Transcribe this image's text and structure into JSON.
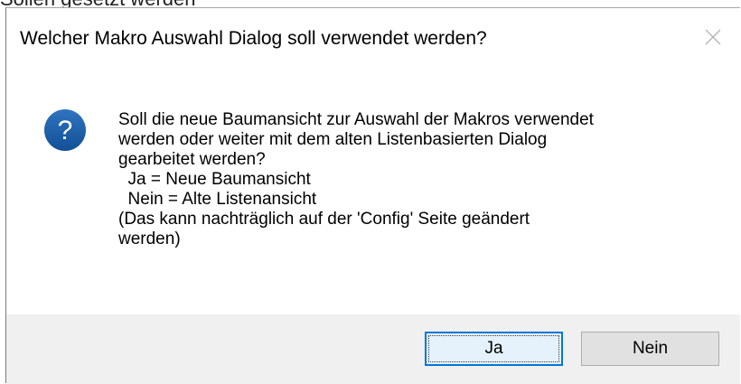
{
  "background": {
    "partial_text": "Sollen gesetzt werden"
  },
  "dialog": {
    "title": "Welcher Makro Auswahl Dialog soll verwendet werden?",
    "close_icon": "close-icon",
    "icon": "question-icon",
    "message_lines": [
      "Soll die neue Baumansicht zur Auswahl der Makros verwendet",
      "werden oder weiter mit dem alten Listenbasierten Dialog",
      "gearbeitet werden?",
      "  Ja = Neue Baumansicht",
      "  Nein = Alte Listenansicht",
      "(Das kann nachträglich auf der 'Config' Seite geändert",
      "werden)"
    ],
    "buttons": {
      "yes_label": "Ja",
      "no_label": "Nein"
    }
  },
  "colors": {
    "accent": "#0078d7",
    "question_icon": "#1e5fa8",
    "footer_bg": "#f0f0f0"
  }
}
